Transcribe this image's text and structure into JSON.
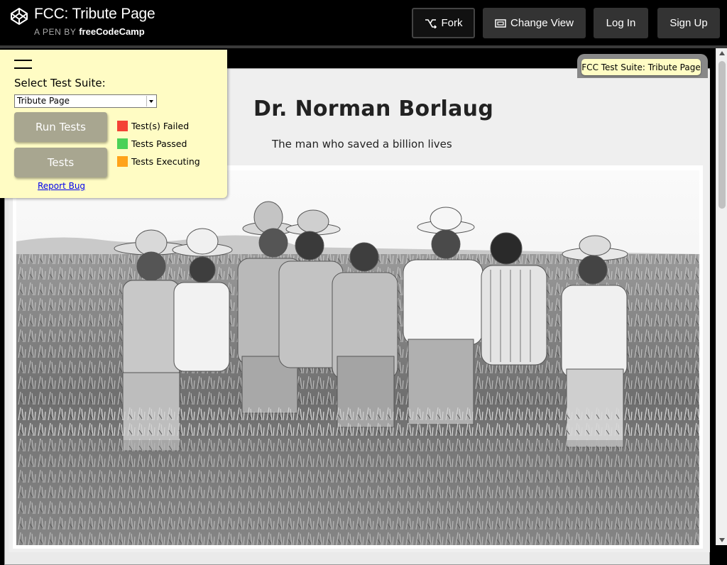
{
  "header": {
    "title": "FCC: Tribute Page",
    "subtitle_prefix": "A PEN BY",
    "author": "freeCodeCamp",
    "buttons": {
      "fork": "Fork",
      "change_view": "Change View",
      "login": "Log In",
      "signup": "Sign Up"
    }
  },
  "page": {
    "heading": "Dr. Norman Borlaug",
    "tagline": "The man who saved a billion lives"
  },
  "test_panel": {
    "select_label": "Select Test Suite:",
    "selected_suite": "Tribute Page",
    "run_button": "Run Tests",
    "tests_button": "Tests",
    "legend": [
      {
        "label": "Test(s) Failed",
        "color": "#f44336"
      },
      {
        "label": "Tests Passed",
        "color": "#4bd157"
      },
      {
        "label": "Tests Executing",
        "color": "#ffa31a"
      }
    ],
    "report_bug": "Report Bug"
  },
  "suite_badge": "FCC Test Suite: Tribute Page",
  "colors": {
    "panel_bg": "#fffcc4",
    "panel_button": "#a8a690",
    "header_bg": "#000000"
  }
}
